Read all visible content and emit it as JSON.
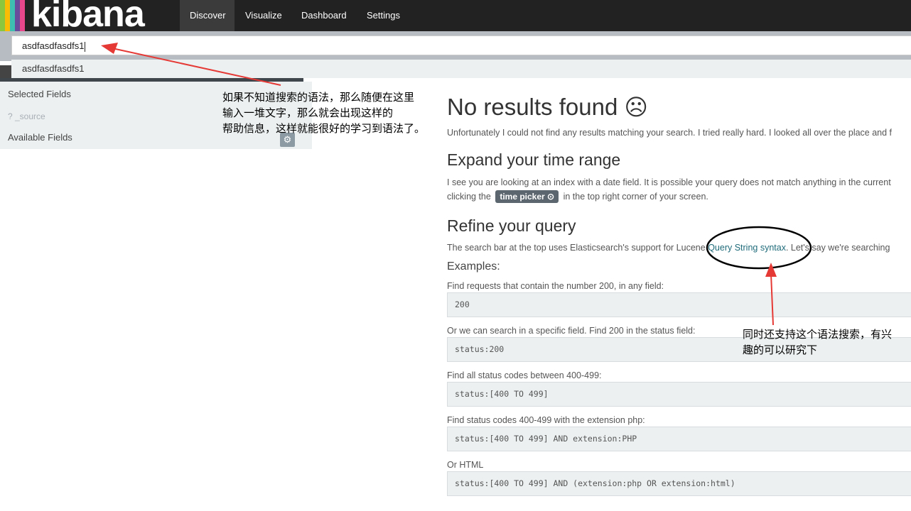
{
  "app": {
    "logo": "kibana",
    "logo_colors": [
      "#e8478b",
      "#3ebeb0",
      "#fbbc05",
      "#8cc63f",
      "#6a4c9c"
    ]
  },
  "nav": {
    "items": [
      {
        "label": "Discover",
        "active": true
      },
      {
        "label": "Visualize",
        "active": false
      },
      {
        "label": "Dashboard",
        "active": false
      },
      {
        "label": "Settings",
        "active": false
      }
    ]
  },
  "search": {
    "value": "asdfasdfasdfs1",
    "suggestion": "asdfasdfasdfs1"
  },
  "sidebar": {
    "selected_fields_label": "Selected Fields",
    "source_field": "? _source",
    "available_fields_label": "Available Fields",
    "gear_icon": "gear-icon"
  },
  "main": {
    "title": "No results found ☺",
    "title_text": "No results found",
    "intro": "Unfortunately I could not find any results matching your search. I tried really hard. I looked all over the place and f",
    "expand_heading": "Expand your time range",
    "expand_line1": "I see you are looking at an index with a date field. It is possible your query does not match anything in the current",
    "expand_line2_pre": "clicking the",
    "time_picker_label": "time picker",
    "expand_line2_post": "in the top right corner of your screen.",
    "refine_heading": "Refine your query",
    "refine_pre": "The search bar at the top uses Elasticsearch's support for Lucene",
    "refine_link": "Query String syntax",
    "refine_post": ". Let's say we're searching",
    "examples_heading": "Examples:",
    "examples": [
      {
        "desc": "Find requests that contain the number 200, in any field:",
        "code": "200"
      },
      {
        "desc": "Or we can search in a specific field. Find 200 in the status field:",
        "code": "status:200"
      },
      {
        "desc": "Find all status codes between 400-499:",
        "code": "status:[400 TO 499]"
      },
      {
        "desc": "Find status codes 400-499 with the extension php:",
        "code": "status:[400 TO 499] AND extension:PHP"
      },
      {
        "desc": "Or HTML",
        "code": "status:[400 TO 499] AND (extension:php OR extension:html)"
      }
    ]
  },
  "annotations": {
    "note1": [
      "如果不知道搜索的语法，那么随便在这里",
      "输入一堆文字，那么就会出现这样的",
      "帮助信息，这样就能很好的学习到语法了。"
    ],
    "note2": [
      "同时还支持这个语法搜索，有兴",
      "趣的可以研究下"
    ],
    "arrow_color": "#e53935"
  }
}
